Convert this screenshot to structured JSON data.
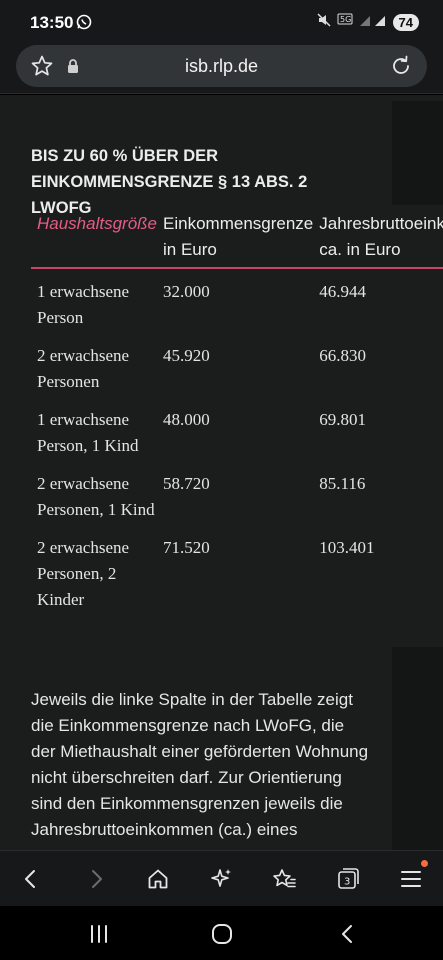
{
  "status": {
    "time": "13:50",
    "battery": "74"
  },
  "browser": {
    "url": "isb.rlp.de",
    "tab_count": "3"
  },
  "content": {
    "heading": "BIS ZU 60 % ÜBER DER EINKOMMENSGRENZE § 13 ABS. 2 LWOFG",
    "table": {
      "headers": [
        "Haushaltsgröße",
        "Einkommensgrenze in Euro",
        "Jahresbruttoeinkommen ca. in Euro"
      ],
      "rows": [
        [
          "1 erwachsene Person",
          "32.000",
          "46.944"
        ],
        [
          "2 erwachsene Personen",
          "45.920",
          "66.830"
        ],
        [
          "1 erwachsene Person, 1 Kind",
          "48.000",
          "69.801"
        ],
        [
          "2 erwachsene Personen, 1 Kind",
          "58.720",
          "85.116"
        ],
        [
          "2 erwachsene Personen, 2 Kinder",
          "71.520",
          "103.401"
        ]
      ]
    },
    "paragraph": "Jeweils die linke Spalte in der Tabelle zeigt die Einkommensgrenze nach LWoFG, die der Miethaushalt einer geförderten Wohnung nicht überschreiten darf. Zur Orientierung sind den Einkommensgrenzen jeweils die Jahresbruttoeinkommen (ca.) eines"
  },
  "colors": {
    "accent": "#e45d86",
    "rule": "#c9466a",
    "page_bg": "#1b1d1c",
    "notification_dot": "#ff6a3c"
  },
  "icons": [
    "whatsapp-icon",
    "mute-icon",
    "5g-icon",
    "signal-icon",
    "star-icon",
    "lock-icon",
    "reload-icon",
    "back-icon",
    "forward-icon",
    "home-icon",
    "sparkle-icon",
    "bookmarks-icon",
    "tabs-icon",
    "menu-icon",
    "recents-icon",
    "home-nav-icon",
    "back-nav-icon"
  ]
}
